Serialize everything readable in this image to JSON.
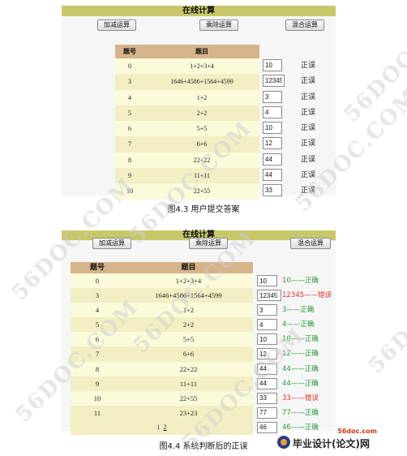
{
  "figure1": {
    "title": "在线计算",
    "buttons": [
      "加减运算",
      "乘除运算",
      "混合运算"
    ],
    "table_headers": [
      "题号",
      "题目"
    ],
    "rows": [
      {
        "id": "0",
        "question": "1+2+3+4",
        "answer": "10",
        "judge": "正误"
      },
      {
        "id": "3",
        "question": "1646+4586+1564+4599",
        "answer": "12345",
        "judge": "正误"
      },
      {
        "id": "4",
        "question": "1+2",
        "answer": "3",
        "judge": "正误"
      },
      {
        "id": "5",
        "question": "2+2",
        "answer": "4",
        "judge": "正误"
      },
      {
        "id": "6",
        "question": "5+5",
        "answer": "10",
        "judge": "正误"
      },
      {
        "id": "7",
        "question": "6+6",
        "answer": "12",
        "judge": "正误"
      },
      {
        "id": "8",
        "question": "22+22",
        "answer": "44",
        "judge": "正误"
      },
      {
        "id": "9",
        "question": "11+11",
        "answer": "44",
        "judge": "正误"
      },
      {
        "id": "10",
        "question": "22+55",
        "answer": "33",
        "judge": "正误"
      }
    ],
    "caption": "图4.3  用户提交答案"
  },
  "figure2": {
    "title": "在线计算",
    "buttons": [
      "加减运算",
      "乘除运算",
      "混合运算"
    ],
    "table_headers": [
      "题号",
      "题目"
    ],
    "rows": [
      {
        "id": "0",
        "question": "1+2+3+4",
        "answer": "10",
        "judge": "10——正确",
        "correct": true
      },
      {
        "id": "3",
        "question": "1646+4586+1564+4599",
        "answer": "12345",
        "judge": "12345——错误",
        "correct": false
      },
      {
        "id": "4",
        "question": "1+2",
        "answer": "3",
        "judge": "3——正确",
        "correct": true
      },
      {
        "id": "5",
        "question": "2+2",
        "answer": "4",
        "judge": "4——正确",
        "correct": true
      },
      {
        "id": "6",
        "question": "5+5",
        "answer": "10",
        "judge": "10——正确",
        "correct": true
      },
      {
        "id": "7",
        "question": "6+6",
        "answer": "12",
        "judge": "12——正确",
        "correct": true
      },
      {
        "id": "8",
        "question": "22+22",
        "answer": "44",
        "judge": "44——正确",
        "correct": true
      },
      {
        "id": "9",
        "question": "11+11",
        "answer": "44",
        "judge": "44——正确",
        "correct": true
      },
      {
        "id": "10",
        "question": "22+55",
        "answer": "33",
        "judge": "33——错误",
        "correct": false
      },
      {
        "id": "11",
        "question": "23+23",
        "answer": "77",
        "judge": "77——正确",
        "correct": true
      }
    ],
    "extra_answer": "46",
    "extra_judge": "46——正确",
    "pages": [
      "1",
      "2"
    ],
    "caption": "图4.4  系统判断后的正误"
  },
  "colors": {
    "correct": "#2a9a3a",
    "wrong": "#e0312f",
    "title_bar": "#c8c86a",
    "table_header": "#d6b48a"
  },
  "watermark": "56DOC.COM",
  "logo": {
    "domain": "56doc.com",
    "text": "毕业设计(论文)网"
  }
}
